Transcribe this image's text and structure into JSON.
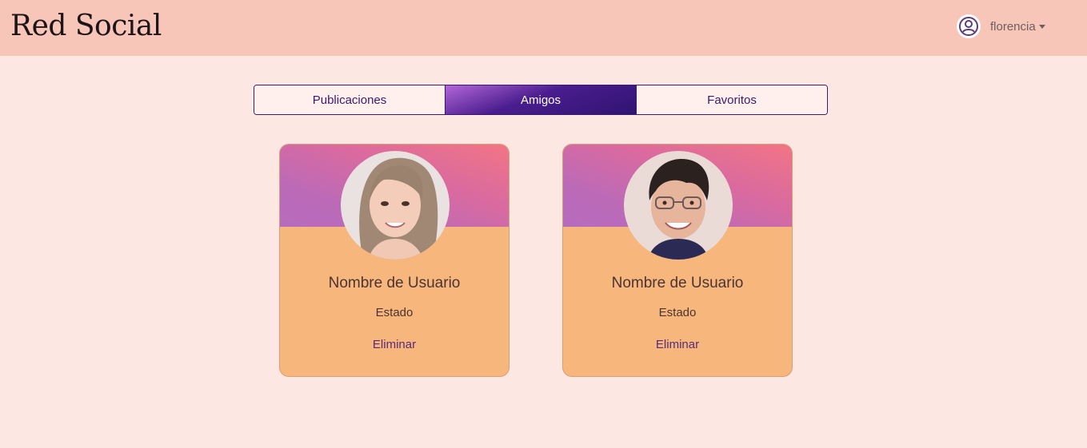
{
  "navbar": {
    "brand": "Red Social",
    "user": {
      "name": "florencia",
      "icon": "user-circle-icon"
    }
  },
  "tabs": [
    {
      "label": "Publicaciones",
      "active": false
    },
    {
      "label": "Amigos",
      "active": true
    },
    {
      "label": "Favoritos",
      "active": false
    }
  ],
  "friends": [
    {
      "name": "Nombre de Usuario",
      "status": "Estado",
      "action": "Eliminar"
    },
    {
      "name": "Nombre de Usuario",
      "status": "Estado",
      "action": "Eliminar"
    }
  ],
  "colors": {
    "page_bg": "#fde7e3",
    "navbar_bg": "#f8c6b9",
    "accent": "#3a1a6e",
    "card_bg": "#f6b67c"
  }
}
